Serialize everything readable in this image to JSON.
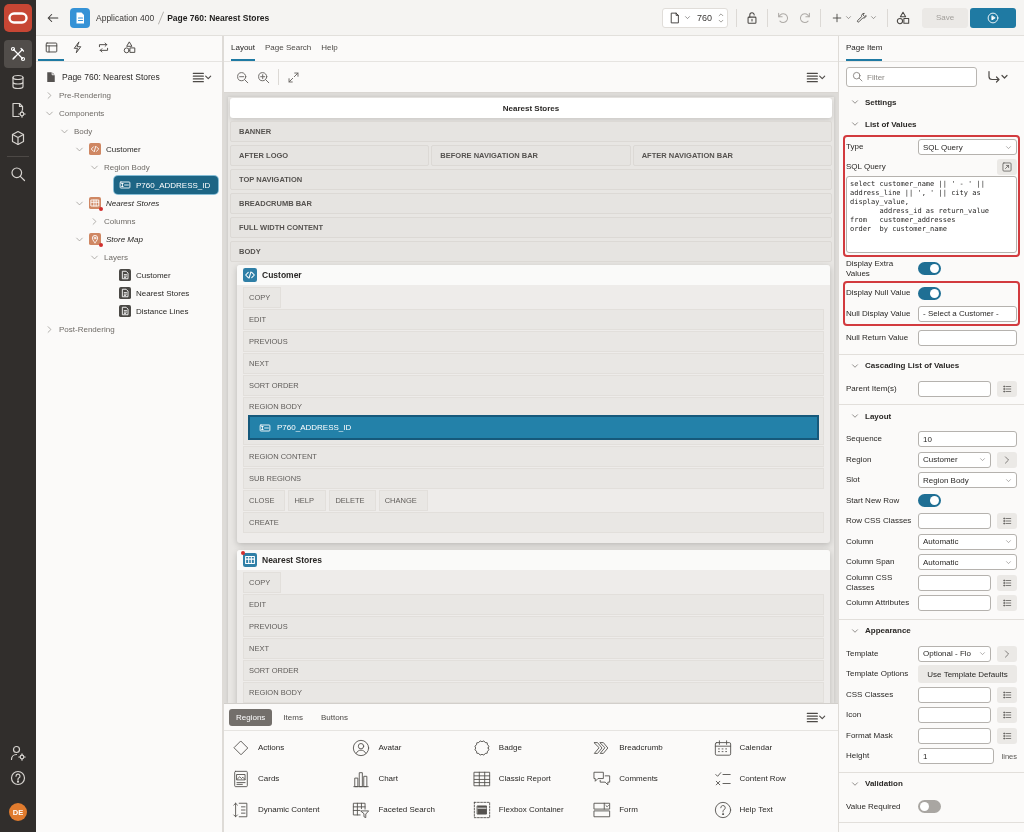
{
  "rail": {
    "items": [
      {
        "kind": "build",
        "selected": true
      },
      {
        "kind": "database",
        "selected": false
      },
      {
        "kind": "document",
        "selected": false
      },
      {
        "kind": "cube",
        "selected": false
      },
      {
        "kind": "search",
        "selected": false
      }
    ],
    "footer": [
      {
        "kind": "user_gear"
      },
      {
        "kind": "help"
      }
    ],
    "avatar": "DE"
  },
  "header": {
    "app": "Application 400",
    "page": "Page 760: Nearest Stores",
    "page_number": "760",
    "history": [
      {
        "kind": "undo",
        "disabled": true
      },
      {
        "kind": "redo",
        "disabled": true
      }
    ],
    "save": {
      "label": "Save",
      "disabled": true
    }
  },
  "left_panel": {
    "tabs": [
      {
        "kind": "panel",
        "selected": true
      },
      {
        "kind": "bolt",
        "selected": false
      },
      {
        "kind": "loop",
        "selected": false
      },
      {
        "kind": "shapes",
        "selected": false
      }
    ],
    "title": "Page 760: Nearest Stores",
    "tree": [
      {
        "label": "Pre-Rendering",
        "kind": "group",
        "expanded": false,
        "selected": false
      },
      {
        "label": "Components",
        "kind": "group",
        "expanded": true,
        "selected": false,
        "children": [
          {
            "label": "Body",
            "kind": "group",
            "expanded": true,
            "selected": false,
            "children": [
              {
                "label": "Customer",
                "kind": "static",
                "expanded": true,
                "selected": false,
                "flagged": false,
                "children": [
                  {
                    "label": "Region Body",
                    "kind": "group",
                    "expanded": true,
                    "selected": false,
                    "children": [
                      {
                        "label": "P760_ADDRESS_ID",
                        "kind": "item",
                        "selected": true
                      }
                    ]
                  }
                ]
              },
              {
                "label": "Nearest Stores",
                "kind": "report",
                "expanded": true,
                "selected": false,
                "flagged": true,
                "children": [
                  {
                    "label": "Columns",
                    "kind": "group",
                    "expanded": false,
                    "selected": false
                  }
                ]
              },
              {
                "label": "Store Map",
                "kind": "map",
                "expanded": true,
                "selected": false,
                "flagged": true,
                "children": [
                  {
                    "label": "Layers",
                    "kind": "group",
                    "expanded": true,
                    "selected": false,
                    "children": [
                      {
                        "label": "Customer",
                        "kind": "layer",
                        "selected": false
                      },
                      {
                        "label": "Nearest Stores",
                        "kind": "layer",
                        "selected": false
                      },
                      {
                        "label": "Distance Lines",
                        "kind": "layer",
                        "selected": false
                      }
                    ]
                  }
                ]
              }
            ]
          }
        ]
      },
      {
        "label": "Post-Rendering",
        "kind": "group",
        "expanded": false,
        "selected": false
      }
    ]
  },
  "layout_editor": {
    "tabs": [
      {
        "label": "Layout",
        "selected": true
      },
      {
        "label": "Page Search",
        "selected": false
      },
      {
        "label": "Help",
        "selected": false
      }
    ],
    "page_title": "Nearest Stores",
    "page_rows": [
      {
        "labels": [
          "BANNER"
        ]
      },
      {
        "labels": [
          "AFTER LOGO",
          "BEFORE NAVIGATION BAR",
          "AFTER NAVIGATION BAR"
        ]
      },
      {
        "labels": [
          "TOP NAVIGATION"
        ]
      },
      {
        "labels": [
          "BREADCRUMB BAR"
        ]
      },
      {
        "labels": [
          "FULL WIDTH CONTENT"
        ]
      },
      {
        "labels": [
          "BODY"
        ]
      }
    ],
    "regions": [
      {
        "title": "Customer",
        "kind": "static",
        "flagged": false,
        "rows": [
          {
            "kind": "buttons",
            "labels": [
              "COPY"
            ]
          },
          {
            "kind": "slot",
            "labels": [
              "EDIT"
            ]
          },
          {
            "kind": "slot",
            "labels": [
              "PREVIOUS"
            ]
          },
          {
            "kind": "slot",
            "labels": [
              "NEXT"
            ]
          },
          {
            "kind": "slot",
            "labels": [
              "SORT ORDER"
            ]
          },
          {
            "kind": "slot",
            "labels": [
              "REGION BODY"
            ],
            "items": [
              {
                "name": "P760_ADDRESS_ID",
                "selected": true
              }
            ]
          },
          {
            "kind": "slot",
            "labels": [
              "REGION CONTENT"
            ]
          },
          {
            "kind": "slot",
            "labels": [
              "SUB REGIONS"
            ]
          },
          {
            "kind": "buttons",
            "labels": [
              "CLOSE",
              "HELP",
              "DELETE",
              "CHANGE"
            ]
          },
          {
            "kind": "slot",
            "labels": [
              "CREATE"
            ]
          }
        ]
      },
      {
        "title": "Nearest Stores",
        "kind": "report",
        "flagged": true,
        "rows": [
          {
            "kind": "buttons",
            "labels": [
              "COPY"
            ]
          },
          {
            "kind": "slot",
            "labels": [
              "EDIT"
            ]
          },
          {
            "kind": "slot",
            "labels": [
              "PREVIOUS"
            ]
          },
          {
            "kind": "slot",
            "labels": [
              "NEXT"
            ]
          },
          {
            "kind": "slot",
            "labels": [
              "SORT ORDER"
            ]
          },
          {
            "kind": "slot",
            "labels": [
              "REGION BODY"
            ]
          }
        ]
      }
    ]
  },
  "gallery": {
    "tabs": [
      {
        "label": "Regions",
        "selected": true
      },
      {
        "label": "Items",
        "selected": false
      },
      {
        "label": "Buttons",
        "selected": false
      }
    ],
    "items": [
      {
        "label": "Actions",
        "kind": "diamond"
      },
      {
        "label": "Avatar",
        "kind": "avatar"
      },
      {
        "label": "Badge",
        "kind": "badge"
      },
      {
        "label": "Breadcrumb",
        "kind": "breadcrumb"
      },
      {
        "label": "Calendar",
        "kind": "calendar"
      },
      {
        "label": "Cards",
        "kind": "cards"
      },
      {
        "label": "Chart",
        "kind": "chart"
      },
      {
        "label": "Classic Report",
        "kind": "table"
      },
      {
        "label": "Comments",
        "kind": "comments"
      },
      {
        "label": "Content Row",
        "kind": "content_row"
      },
      {
        "label": "Dynamic Content",
        "kind": "dynamic_content"
      },
      {
        "label": "Faceted Search",
        "kind": "faceted_search"
      },
      {
        "label": "Flexbox Container",
        "kind": "flexbox"
      },
      {
        "label": "Form",
        "kind": "form"
      },
      {
        "label": "Help Text",
        "kind": "help"
      }
    ]
  },
  "property_editor": {
    "tabs": [
      {
        "label": "Page Item",
        "selected": true
      }
    ],
    "filter_placeholder": "Filter",
    "sections": [
      {
        "title": "Settings",
        "expanded": true
      },
      {
        "title": "List of Values",
        "expanded": true,
        "groups": [
          {
            "highlighted": true,
            "fields": [
              {
                "label": "Type",
                "kind": "select",
                "value": "SQL Query"
              },
              {
                "label": "SQL Query",
                "kind": "code",
                "addon": {
                  "kind": "expand"
                },
                "value": "select customer_name || ' - ' || address_line || ', ' || city as display_value,\n       address_id as return_value\nfrom   customer_addresses\norder  by customer_name"
              }
            ]
          },
          {
            "highlighted": false,
            "fields": [
              {
                "label": "Display Extra Values",
                "kind": "toggle",
                "on": true
              }
            ]
          },
          {
            "highlighted": true,
            "fields": [
              {
                "label": "Display Null Value",
                "kind": "toggle",
                "on": true
              },
              {
                "label": "Null Display Value",
                "kind": "text",
                "value": "- Select a Customer -"
              }
            ]
          },
          {
            "highlighted": false,
            "fields": [
              {
                "label": "Null Return Value",
                "kind": "text"
              }
            ]
          }
        ]
      },
      {
        "title": "Cascading List of Values",
        "expanded": true,
        "groups": [
          {
            "highlighted": false,
            "fields": [
              {
                "label": "Parent Item(s)",
                "kind": "text",
                "addon": {
                  "kind": "list"
                }
              }
            ]
          }
        ]
      },
      {
        "title": "Layout",
        "expanded": true,
        "groups": [
          {
            "highlighted": false,
            "fields": [
              {
                "label": "Sequence",
                "kind": "text",
                "value": "10"
              },
              {
                "label": "Region",
                "kind": "select",
                "value": "Customer",
                "addon": {
                  "kind": "next"
                }
              },
              {
                "label": "Slot",
                "kind": "select",
                "value": "Region Body"
              },
              {
                "label": "Start New Row",
                "kind": "toggle",
                "on": true
              },
              {
                "label": "Row CSS Classes",
                "kind": "text",
                "addon": {
                  "kind": "list"
                }
              },
              {
                "label": "Column",
                "kind": "select",
                "value": "Automatic"
              },
              {
                "label": "Column Span",
                "kind": "select",
                "value": "Automatic"
              },
              {
                "label": "Column CSS Classes",
                "kind": "text",
                "addon": {
                  "kind": "list"
                }
              },
              {
                "label": "Column Attributes",
                "kind": "text",
                "addon": {
                  "kind": "list"
                }
              }
            ]
          }
        ]
      },
      {
        "title": "Appearance",
        "expanded": true,
        "groups": [
          {
            "highlighted": false,
            "fields": [
              {
                "label": "Template",
                "kind": "select",
                "value": "Optional - Flo",
                "addon": {
                  "kind": "next"
                }
              },
              {
                "label": "Template Options",
                "kind": "button",
                "value": "Use Template Defaults"
              },
              {
                "label": "CSS Classes",
                "kind": "text",
                "addon": {
                  "kind": "list"
                }
              },
              {
                "label": "Icon",
                "kind": "text",
                "addon": {
                  "kind": "list"
                }
              },
              {
                "label": "Format Mask",
                "kind": "text",
                "addon": {
                  "kind": "list"
                }
              },
              {
                "label": "Height",
                "kind": "text",
                "value": "1",
                "suffix": "lines"
              }
            ]
          }
        ]
      },
      {
        "title": "Validation",
        "expanded": true,
        "groups": [
          {
            "highlighted": false,
            "fields": [
              {
                "label": "Value Required",
                "kind": "toggle",
                "on": false
              }
            ]
          }
        ]
      }
    ]
  }
}
